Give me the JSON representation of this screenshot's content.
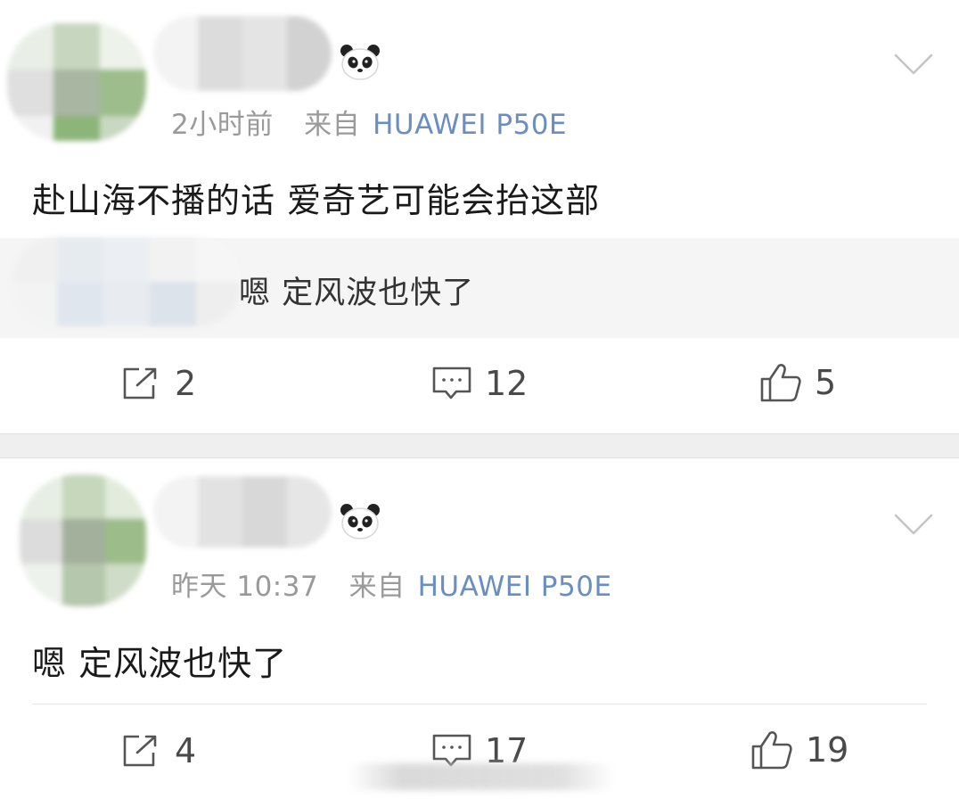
{
  "posts": [
    {
      "meta": {
        "time": "2小时前",
        "from_label": "来自",
        "device": "HUAWEI P50E"
      },
      "body": "赴山海不播的话 爱奇艺可能会抬这部",
      "quote": "嗯 定风波也快了",
      "actions": {
        "share_count": "2",
        "comment_count": "12",
        "like_count": "5"
      }
    },
    {
      "meta": {
        "time": "昨天 10:37",
        "from_label": "来自",
        "device": "HUAWEI P50E"
      },
      "body": "嗯 定风波也快了",
      "actions": {
        "share_count": "4",
        "comment_count": "17",
        "like_count": "19"
      }
    }
  ],
  "colors": {
    "link": "#6a8ec1",
    "meta": "#9a9a9a",
    "divider": "#efefef",
    "quote_bg": "#f5f5f5"
  },
  "icons": {
    "badge": "panda-icon",
    "menu": "chevron-down-icon",
    "share": "share-icon",
    "comment": "comment-icon",
    "like": "thumbs-up-icon"
  }
}
